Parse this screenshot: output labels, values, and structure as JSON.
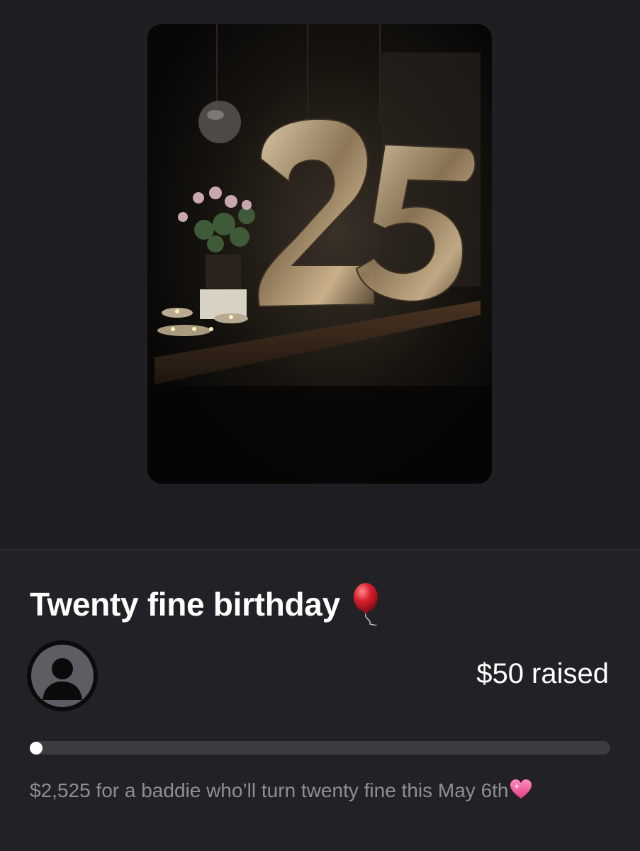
{
  "fundraiser": {
    "title": "Twenty fine birthday",
    "title_emoji": "balloon-icon",
    "raised_text": "$50 raised",
    "raised_amount": 50,
    "goal_amount": 2525,
    "progress_fraction": 0.02,
    "description": "$2,525 for a baddie who’ll turn twenty fine this May 6th",
    "description_emoji": "sparkling-heart-icon"
  },
  "organizer": {
    "avatar": "person-placeholder-icon"
  },
  "colors": {
    "background": "#1f1e23",
    "panel": "#222126",
    "progress_track": "#3c3b41",
    "progress_knob": "#ffffff",
    "secondary_text": "#8f8e94",
    "balloon": "#d91f2e",
    "heart": "#f25aa0"
  }
}
